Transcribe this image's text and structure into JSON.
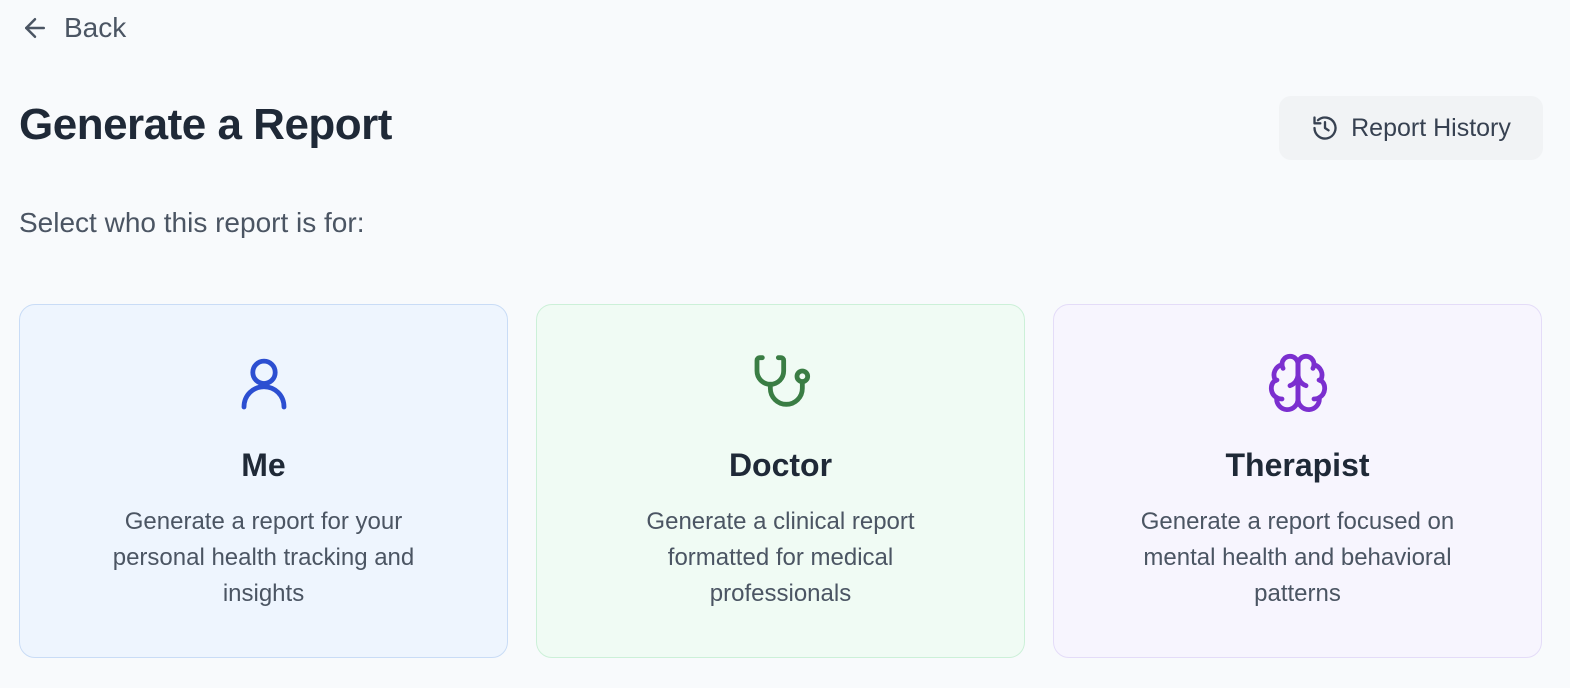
{
  "nav": {
    "back_label": "Back",
    "back_icon": "arrow-left-icon"
  },
  "header": {
    "title": "Generate a Report",
    "history_button_label": "Report History",
    "history_icon": "history-clock-icon"
  },
  "prompt": "Select who this report is for:",
  "options": [
    {
      "title": "Me",
      "description": "Generate a report for your personal health tracking and insights",
      "icon": "user-icon",
      "accent": "#2c4fd1",
      "background": "#eef5fe",
      "border": "#c9dcf6"
    },
    {
      "title": "Doctor",
      "description": "Generate a clinical report formatted for medical professionals",
      "icon": "stethoscope-icon",
      "accent": "#3a7d44",
      "background": "#f0fbf4",
      "border": "#ccf0d8"
    },
    {
      "title": "Therapist",
      "description": "Generate a report focused on mental health and behavioral patterns",
      "icon": "brain-icon",
      "accent": "#7b2fcf",
      "background": "#f7f5fe",
      "border": "#e4dcf8"
    }
  ]
}
